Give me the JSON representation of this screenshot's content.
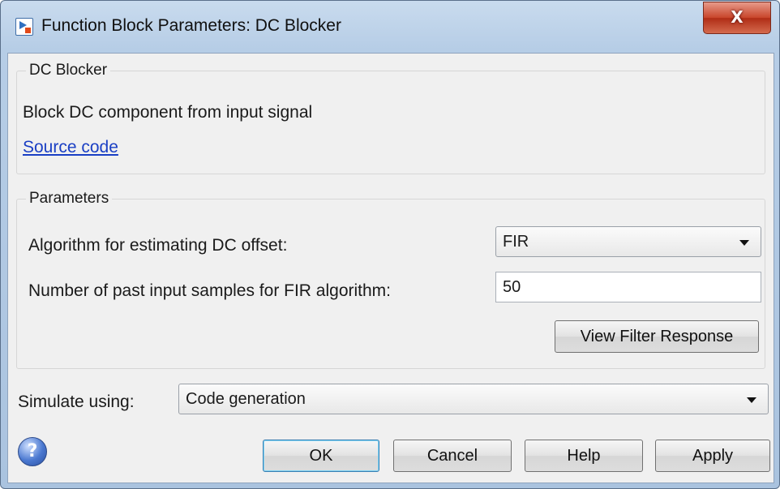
{
  "window": {
    "title": "Function Block Parameters: DC Blocker",
    "close_label": "X"
  },
  "block_group": {
    "legend": "DC Blocker",
    "description": "Block DC component from input signal",
    "link_label": "Source code"
  },
  "parameters": {
    "legend": "Parameters",
    "algorithm_label": "Algorithm for estimating DC offset:",
    "algorithm_value": "FIR",
    "samples_label": "Number of past input samples for FIR algorithm:",
    "samples_value": "50",
    "view_filter_label": "View Filter Response"
  },
  "simulate": {
    "label": "Simulate using:",
    "value": "Code generation"
  },
  "footer": {
    "help_icon": "question-icon",
    "ok_label": "OK",
    "cancel_label": "Cancel",
    "help_label": "Help",
    "apply_label": "Apply"
  }
}
